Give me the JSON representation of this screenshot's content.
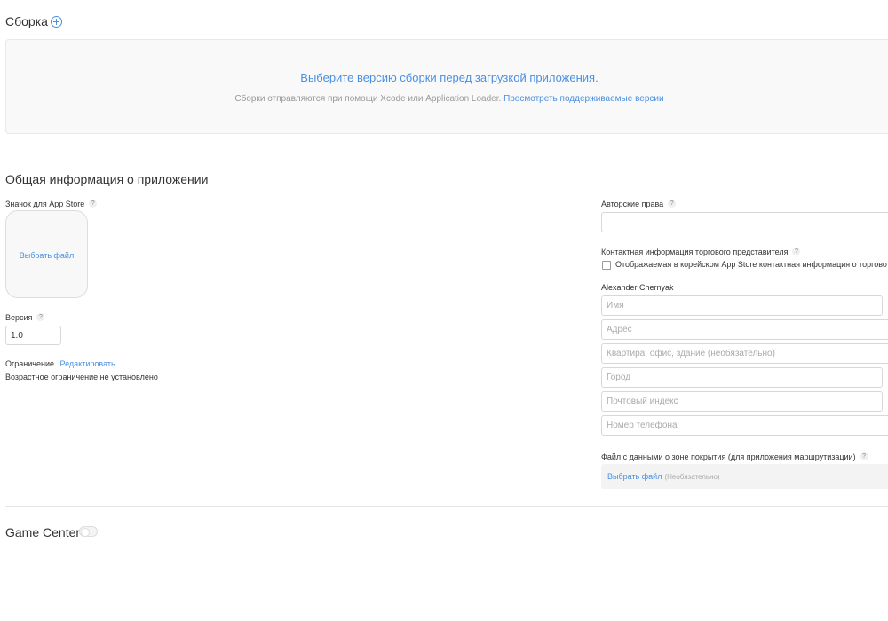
{
  "build": {
    "title": "Сборка",
    "main_message": "Выберите версию сборки перед загрузкой приложения.",
    "sub_message": "Сборки отправляются при помощи Xcode или Application Loader.",
    "supported_versions_link": "Просмотреть поддерживаемые версии"
  },
  "general": {
    "title": "Общая информация о приложении",
    "app_store_icon_label": "Значок для App Store",
    "choose_file": "Выбрать файл",
    "version_label": "Версия",
    "version_value": "1.0",
    "restriction_label": "Ограничение",
    "restriction_edit": "Редактировать",
    "restriction_value": "Возрастное ограничение не установлено",
    "help_glyph": "?"
  },
  "right": {
    "copyright_label": "Авторские права",
    "copyright_value": "",
    "contact_label": "Контактная информация торгового представителя",
    "korean_checkbox_label": "Отображаемая в корейском App Store контактная информация о торгово",
    "contact_name": "Alexander Chernyak",
    "fields": {
      "name": "Имя",
      "address": "Адрес",
      "apartment": "Квартира, офис, здание (необязательно)",
      "city": "Город",
      "postal": "Почтовый индекс",
      "phone": "Номер телефона"
    },
    "coverage_label": "Файл с данными о зоне покрытия (для приложения маршрутизации)",
    "coverage_choose": "Выбрать файл",
    "coverage_optional": "(Необязательно)"
  },
  "game_center": {
    "title": "Game Center",
    "enabled": false
  },
  "colors": {
    "accent": "#4a90e2",
    "text": "#333333",
    "muted": "#999999"
  }
}
